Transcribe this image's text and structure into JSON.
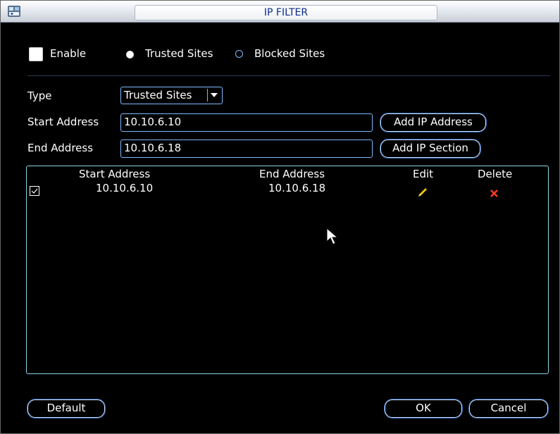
{
  "window": {
    "title": "IP FILTER"
  },
  "filter": {
    "enable_label": "Enable",
    "enable_checked": false,
    "mode_options": [
      "Trusted Sites",
      "Blocked Sites"
    ],
    "mode_selected": "Trusted Sites"
  },
  "form": {
    "type_label": "Type",
    "type_value": "Trusted Sites",
    "start_label": "Start Address",
    "start_value": "10.10.6.10",
    "end_label": "End Address",
    "end_value": "10.10.6.18",
    "add_ip_button": "Add IP Address",
    "add_section_button": "Add IP Section"
  },
  "table": {
    "columns": [
      "Start Address",
      "End Address",
      "Edit",
      "Delete"
    ],
    "rows": [
      {
        "checked": true,
        "start": "10.10.6.10",
        "end": "10.10.6.18",
        "edit_icon": "pencil-icon",
        "delete_icon": "red-x-icon"
      }
    ]
  },
  "footer": {
    "default_button": "Default",
    "ok_button": "OK",
    "cancel_button": "Cancel"
  },
  "colors": {
    "accent_border": "#7fb8ff",
    "table_border": "#8ad6e4",
    "title_text": "#0b2b8c",
    "delete_red": "#ff3b1f",
    "edit_yellow": "#f4c400"
  }
}
